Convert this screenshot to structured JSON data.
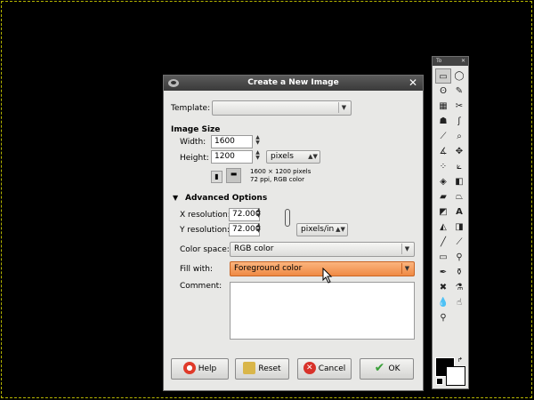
{
  "dialog": {
    "title": "Create a New Image",
    "template_label": "Template:",
    "template_value": "",
    "image_size_header": "Image Size",
    "width_label": "Width:",
    "width_value": "1600",
    "height_label": "Height:",
    "height_value": "1200",
    "units": "pixels",
    "size_info_line1": "1600 × 1200 pixels",
    "size_info_line2": "72 ppi, RGB color",
    "advanced_label": "Advanced Options",
    "xres_label": "X resolution:",
    "xres_value": "72.000",
    "yres_label": "Y resolution:",
    "yres_value": "72.000",
    "res_units": "pixels/in",
    "colorspace_label": "Color space:",
    "colorspace_value": "RGB color",
    "fill_label": "Fill with:",
    "fill_value": "Foreground color",
    "comment_label": "Comment:",
    "comment_value": "",
    "buttons": {
      "help": "Help",
      "reset": "Reset",
      "cancel": "Cancel",
      "ok": "OK"
    }
  },
  "toolbox": {
    "title": "To"
  },
  "colors": {
    "fill_highlight": "#ef8a44",
    "foreground": "#000000",
    "background": "#ffffff"
  }
}
